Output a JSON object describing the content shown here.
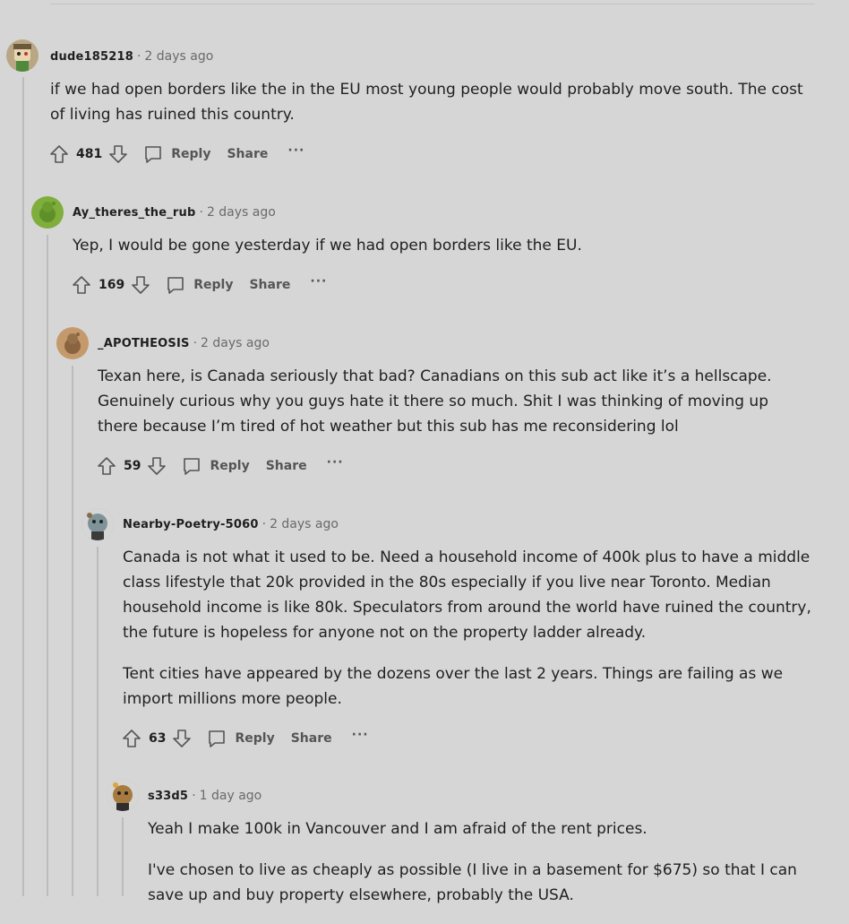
{
  "comments": [
    {
      "author": "dude185218",
      "time": "2 days ago",
      "avatar_icon": "snoo-avatar-icon",
      "paragraphs": [
        "if we had open borders like the in the EU most young people would probably move south. The cost of living has ruined this country."
      ],
      "score": "481",
      "reply_label": "Reply",
      "share_label": "Share",
      "more_label": "···"
    },
    {
      "author": "Ay_theres_the_rub",
      "time": "2 days ago",
      "avatar_icon": "snoo-avatar-icon",
      "paragraphs": [
        "Yep, I would be gone yesterday if we had open borders like the EU."
      ],
      "score": "169",
      "reply_label": "Reply",
      "share_label": "Share",
      "more_label": "···"
    },
    {
      "author": "_APOTHEOSIS",
      "time": "2 days ago",
      "avatar_icon": "snoo-avatar-icon",
      "paragraphs": [
        "Texan here, is Canada seriously that bad? Canadians on this sub act like it’s a hellscape. Genuinely curious why you guys hate it there so much. Shit I was thinking of moving up there because I’m tired of hot weather but this sub has me reconsidering lol"
      ],
      "score": "59",
      "reply_label": "Reply",
      "share_label": "Share",
      "more_label": "···"
    },
    {
      "author": "Nearby-Poetry-5060",
      "time": "2 days ago",
      "avatar_icon": "snoo-avatar-icon",
      "paragraphs": [
        "Canada is not what it used to be. Need a household income of 400k plus to have a middle class lifestyle that 20k provided in the 80s especially if you live near Toronto. Median household income is like 80k. Speculators from around the world have ruined the country, the future is hopeless for anyone not on the property ladder already.",
        "Tent cities have appeared by the dozens over the last 2 years. Things are failing as we import millions more people."
      ],
      "score": "63",
      "reply_label": "Reply",
      "share_label": "Share",
      "more_label": "···"
    },
    {
      "author": "s33d5",
      "time": "1 day ago",
      "avatar_icon": "snoo-avatar-icon",
      "paragraphs": [
        "Yeah I make 100k in Vancouver and I am afraid of the rent prices.",
        "I've chosen to live as cheaply as possible (I live in a basement for $675) so that I can save up and buy property elsewhere, probably the USA."
      ]
    }
  ],
  "colors": {
    "background": "#d6d6d6",
    "thread_line": "#bcbcbc",
    "avatar_1": "#b9a684",
    "avatar_2": "#7fae3c",
    "avatar_3": "#c49a6c",
    "avatar_4": "#8fa3a8",
    "avatar_5": "#c9a46a"
  }
}
